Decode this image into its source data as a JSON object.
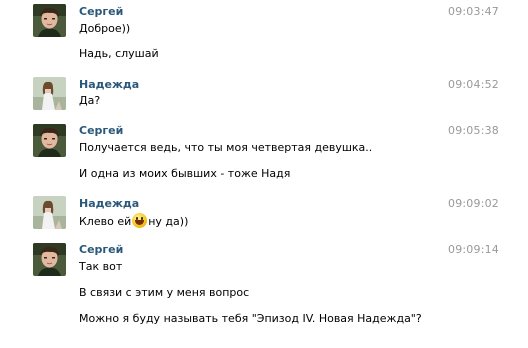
{
  "messages": [
    {
      "author": "Сергей",
      "time": "09:03:47",
      "avatar": "sergey-avatar",
      "lines": [
        "Доброе))",
        "Надь, слушай"
      ]
    },
    {
      "author": "Надежда",
      "time": "09:04:52",
      "avatar": "nadezhda-avatar",
      "lines": [
        "Да?"
      ]
    },
    {
      "author": "Сергей",
      "time": "09:05:38",
      "avatar": "sergey-avatar",
      "lines": [
        "Получается ведь, что ты моя четвертая девушка..",
        "И одна из моих бывших - тоже Надя"
      ]
    },
    {
      "author": "Надежда",
      "time": "09:09:02",
      "avatar": "nadezhda-avatar",
      "line_before_emoji": "Клево ей",
      "emoji": "smile-emoji",
      "line_after_emoji": "ну да))"
    },
    {
      "author": "Сергей",
      "time": "09:09:14",
      "avatar": "sergey-avatar",
      "lines": [
        "Так вот",
        "В связи с этим у меня вопрос",
        "Можно я буду называть тебя \"Эпизод IV. Новая Надежда\"?"
      ]
    }
  ],
  "colors": {
    "author": "#2b587a",
    "time": "#999999",
    "text": "#000000"
  }
}
